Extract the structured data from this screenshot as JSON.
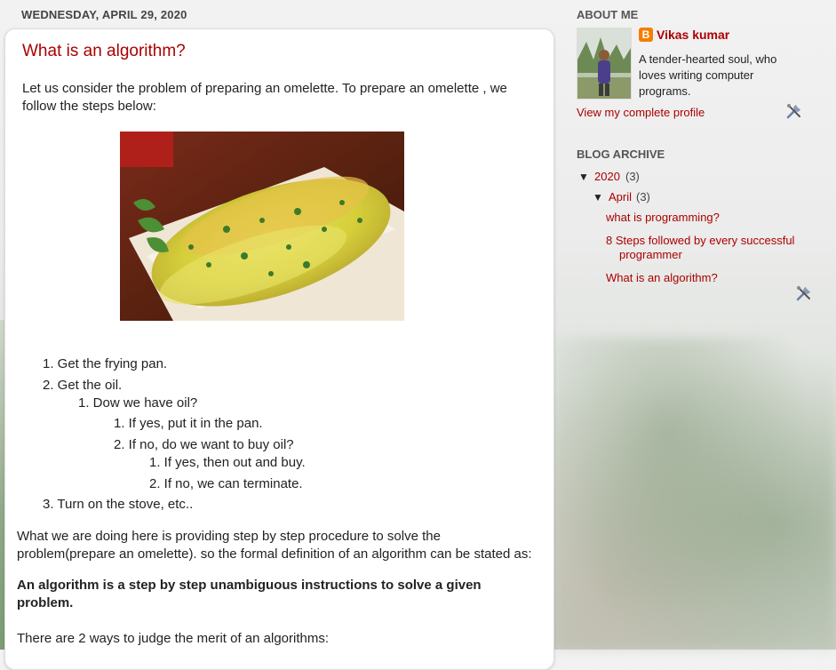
{
  "post": {
    "date": "WEDNESDAY, APRIL 29, 2020",
    "title": "What is an algorithm?",
    "intro": "Let us consider the problem of preparing an omelette. To prepare an omelette , we follow the steps below:",
    "steps": [
      "1. Get the frying pan.",
      "2. Get the oil.",
      "1. Dow we have oil?",
      "1. If yes, put it in the pan.",
      "2. If no, do we want to buy oil?",
      "1. If yes, then out and buy.",
      "2. If no, we can terminate.",
      "3. Turn on the stove, etc.."
    ],
    "paragraph": "What we are doing here is providing step by step procedure to solve the problem(prepare an omelette). so the formal definition of an algorithm can be stated as:",
    "definition": "An algorithm is a step by step unambiguous instructions to solve a given problem.",
    "merit": "There are 2 ways to judge the merit of an algorithms:"
  },
  "about": {
    "heading": "ABOUT ME",
    "name": "Vikas kumar",
    "description": "A tender-hearted soul, who loves writing computer programs.",
    "profile_link": "View my complete profile"
  },
  "archive": {
    "heading": "BLOG ARCHIVE",
    "year_toggle": "▼",
    "year": "2020",
    "year_count": "(3)",
    "month_toggle": "▼",
    "month": "April",
    "month_count": "(3)",
    "posts": [
      "what is programming?",
      "8 Steps followed by every successful programmer",
      "What is an algorithm?"
    ]
  },
  "colors": {
    "accent": "#aa0000",
    "blogger": "#f57d00"
  }
}
